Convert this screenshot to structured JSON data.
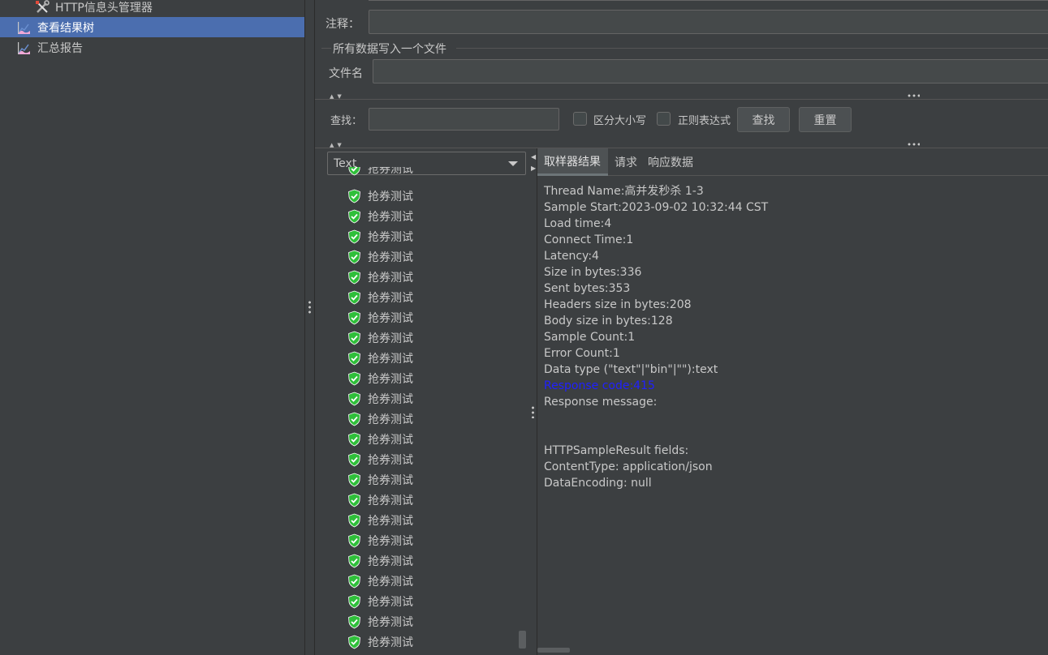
{
  "tree": {
    "items": [
      {
        "label": "HTTP信息头管理器",
        "icon": "wrench-screwdriver-icon",
        "selected": false
      },
      {
        "label": "查看结果树",
        "icon": "chart-listener-icon",
        "selected": true
      },
      {
        "label": "汇总报告",
        "icon": "chart-listener-icon",
        "selected": false
      }
    ]
  },
  "form": {
    "comment_label": "注释：",
    "comment_value": "",
    "file_group_title": "所有数据写入一个文件",
    "filename_label": "文件名",
    "filename_value": ""
  },
  "search": {
    "label": "查找：",
    "value": "",
    "case_label": "区分大小写",
    "case_checked": false,
    "regex_label": "正则表达式",
    "regex_checked": false,
    "find_button": "查找",
    "reset_button": "重置"
  },
  "results": {
    "renderer": "Text",
    "partial_top_label": "抢券测试",
    "items": [
      "抢券测试",
      "抢券测试",
      "抢券测试",
      "抢券测试",
      "抢券测试",
      "抢券测试",
      "抢券测试",
      "抢券测试",
      "抢券测试",
      "抢券测试",
      "抢券测试",
      "抢券测试",
      "抢券测试",
      "抢券测试",
      "抢券测试",
      "抢券测试",
      "抢券测试",
      "抢券测试",
      "抢券测试",
      "抢券测试",
      "抢券测试",
      "抢券测试",
      "抢券测试"
    ],
    "status": "success"
  },
  "details": {
    "tabs": [
      {
        "label": "取样器结果",
        "active": true
      },
      {
        "label": "请求",
        "active": false
      },
      {
        "label": "响应数据",
        "active": false
      }
    ],
    "lines": [
      "Thread Name:高并发秒杀 1-3",
      "Sample Start:2023-09-02 10:32:44 CST",
      "Load time:4",
      "Connect Time:1",
      "Latency:4",
      "Size in bytes:336",
      "Sent bytes:353",
      "Headers size in bytes:208",
      "Body size in bytes:128",
      "Sample Count:1",
      "Error Count:1",
      "Data type (\"text\"|\"bin\"|\"\"):text",
      "Response code:415",
      "Response message:",
      "",
      "",
      "HTTPSampleResult fields:",
      "ContentType: application/json",
      "DataEncoding: null"
    ],
    "highlight_index": 12,
    "highlight_color": "#2020ff"
  },
  "colors": {
    "background": "#3c3f41",
    "selection": "#4b6eaf",
    "success_green": "#2fbf3a"
  }
}
